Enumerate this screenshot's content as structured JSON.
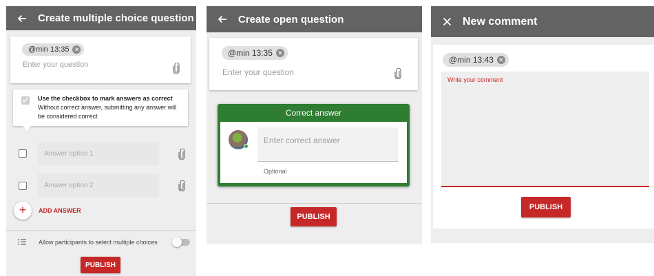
{
  "screen1": {
    "title": "Create multiple choice question",
    "nav_icon": "arrow-back-icon",
    "chip": "@min 13:35",
    "question_placeholder": "Enter your question",
    "tooltip_line1": "Use the checkbox to mark answers as correct",
    "tooltip_line2": "Without correct answer, submitting any answer will",
    "tooltip_line3": "be considered correct",
    "answers": [
      "Answer option 1",
      "Answer option 2"
    ],
    "add_answer": "ADD ANSWER",
    "multi_select_label": "Allow participants to select multiple choices",
    "publish": "PUBLISH"
  },
  "screen2": {
    "title": "Create open question",
    "nav_icon": "arrow-back-icon",
    "chip": "@min 13:35",
    "question_placeholder": "Enter your question",
    "correct_header": "Correct answer",
    "correct_placeholder": "Enter correct answer",
    "optional": "Optional",
    "publish": "PUBLISH"
  },
  "screen3": {
    "title": "New comment",
    "nav_icon": "close-icon",
    "chip": "@min 13:43",
    "comment_placeholder": "Write your comment",
    "publish": "PUBLISH"
  },
  "colors": {
    "appbar": "#636363",
    "accent_red": "#c62828",
    "correct_green": "#2e7d32"
  }
}
